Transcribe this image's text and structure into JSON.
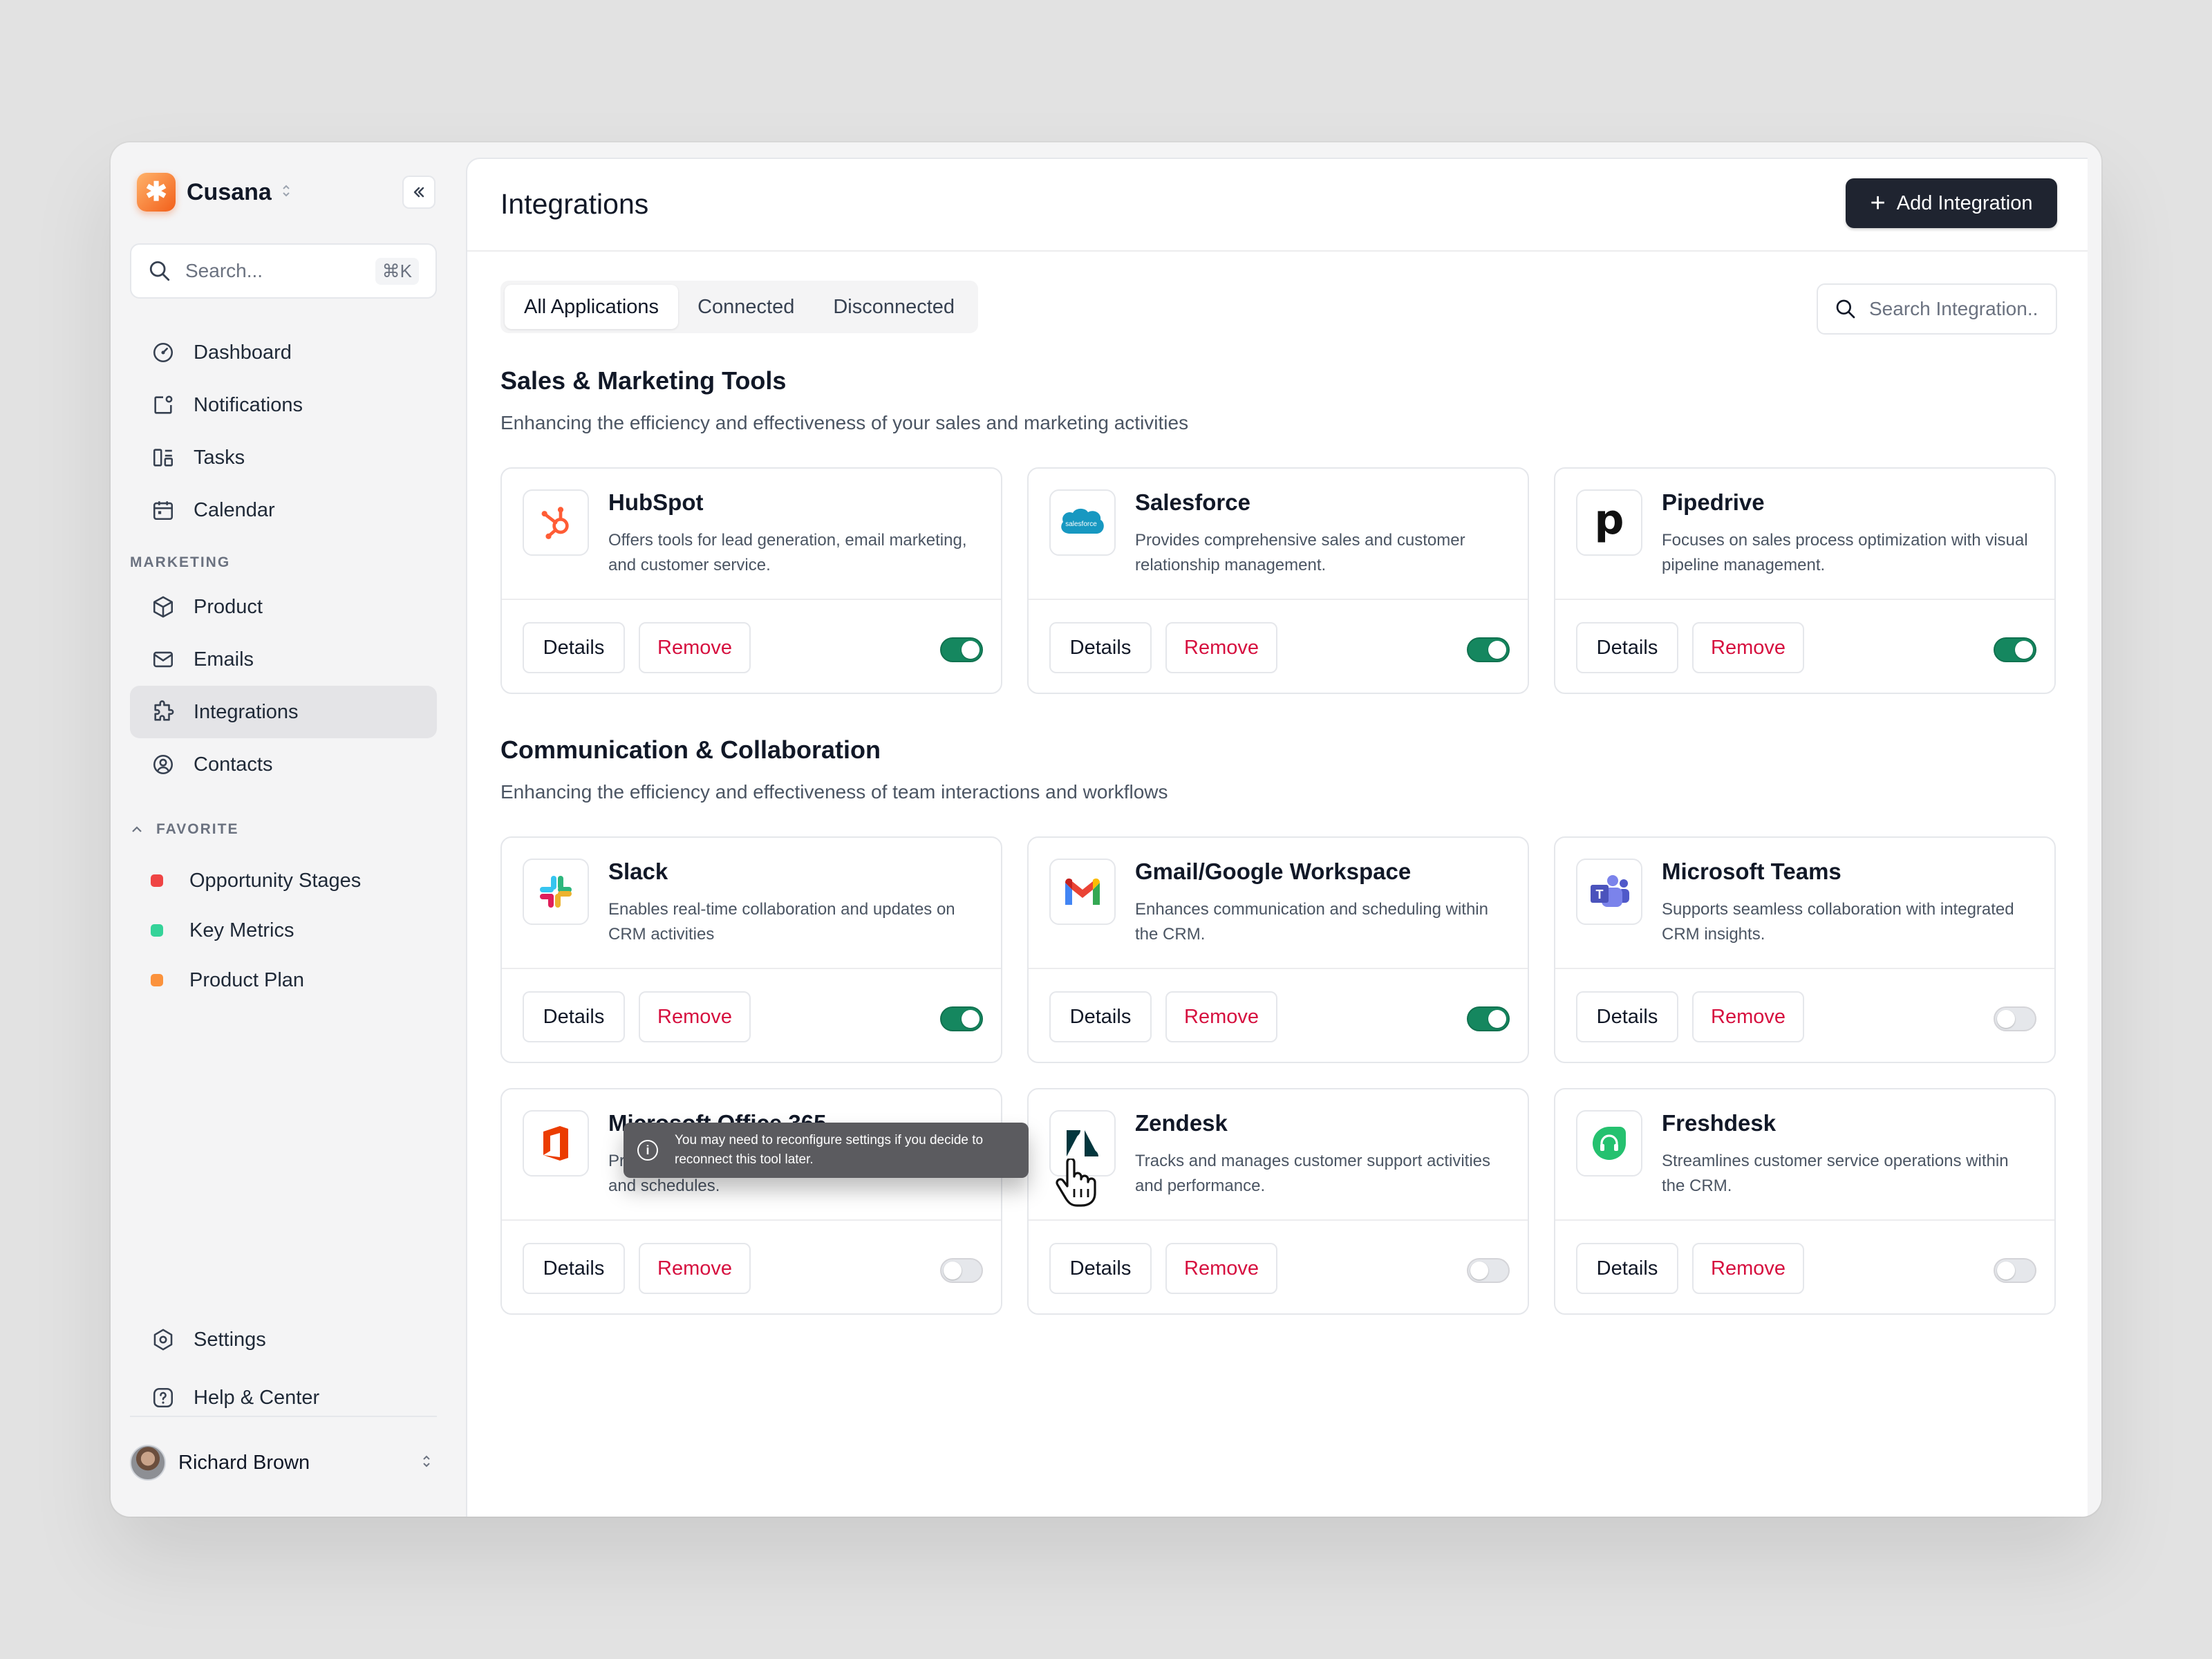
{
  "brand": {
    "name": "Cusana",
    "logo_glyph": "✱"
  },
  "sidebar": {
    "search_placeholder": "Search...",
    "search_shortcut": "⌘K",
    "nav": [
      {
        "label": "Dashboard",
        "icon": "dashboard-icon"
      },
      {
        "label": "Notifications",
        "icon": "notification-icon"
      },
      {
        "label": "Tasks",
        "icon": "tasks-icon"
      },
      {
        "label": "Calendar",
        "icon": "calendar-icon"
      }
    ],
    "marketing_label": "MARKETING",
    "marketing": [
      {
        "label": "Product",
        "icon": "cube-icon"
      },
      {
        "label": "Emails",
        "icon": "mail-icon"
      },
      {
        "label": "Integrations",
        "icon": "puzzle-icon",
        "active": true
      },
      {
        "label": "Contacts",
        "icon": "user-circle-icon"
      }
    ],
    "favorite_label": "FAVORITE",
    "favorites": [
      {
        "label": "Opportunity Stages",
        "color": "#ef4444"
      },
      {
        "label": "Key Metrics",
        "color": "#34d399"
      },
      {
        "label": "Product Plan",
        "color": "#fb923c"
      }
    ],
    "bottom": [
      {
        "label": "Settings",
        "icon": "settings-icon"
      },
      {
        "label": "Help & Center",
        "icon": "help-icon"
      }
    ],
    "user": {
      "name": "Richard Brown"
    }
  },
  "header": {
    "title": "Integrations",
    "add_button": "Add Integration"
  },
  "tabs": [
    {
      "label": "All Applications",
      "active": true
    },
    {
      "label": "Connected"
    },
    {
      "label": "Disconnected"
    }
  ],
  "search": {
    "placeholder": "Search Integration.."
  },
  "sections": [
    {
      "title": "Sales & Marketing Tools",
      "description": "Enhancing the efficiency and effectiveness of your sales and marketing activities",
      "cards": [
        {
          "name": "HubSpot",
          "description": "Offers tools for lead generation, email marketing, and customer service.",
          "enabled": true,
          "logo": "hubspot-logo"
        },
        {
          "name": "Salesforce",
          "description": "Provides comprehensive sales and customer relationship management.",
          "enabled": true,
          "logo": "salesforce-logo",
          "logo_text": "salesforce"
        },
        {
          "name": "Pipedrive",
          "description": "Focuses on sales process optimization with visual pipeline management.",
          "enabled": true,
          "logo": "pipedrive-logo",
          "logo_text": "p"
        }
      ]
    },
    {
      "title": "Communication & Collaboration",
      "description": "Enhancing the efficiency and effectiveness of team interactions and workflows",
      "cards": [
        {
          "name": "Slack",
          "description": "Enables real-time collaboration and updates on CRM activities",
          "enabled": true,
          "logo": "slack-logo"
        },
        {
          "name": "Gmail/Google Workspace",
          "description": "Enhances communication and scheduling within the CRM.",
          "enabled": true,
          "logo": "gmail-logo"
        },
        {
          "name": "Microsoft Teams",
          "description": "Supports seamless collaboration with integrated CRM insights.",
          "enabled": false,
          "logo": "teams-logo",
          "logo_text": "T"
        },
        {
          "name": "Microsoft Office 365",
          "description": "Provides a unified view of customer interactions and schedules.",
          "enabled": false,
          "logo": "office365-logo"
        },
        {
          "name": "Zendesk",
          "description": "Tracks and manages customer support activities and performance.",
          "enabled": false,
          "logo": "zendesk-logo"
        },
        {
          "name": "Freshdesk",
          "description": "Streamlines customer service operations within the CRM.",
          "enabled": false,
          "logo": "freshdesk-logo"
        }
      ]
    }
  ],
  "card_buttons": {
    "details": "Details",
    "remove": "Remove"
  },
  "tooltip": {
    "text": "You may need to reconfigure settings if you decide to reconnect this tool later.",
    "icon_glyph": "i"
  },
  "colors": {
    "toggle_on": "#15875f",
    "remove_text": "#d6103f",
    "add_button_bg": "#1f2430",
    "brand_orange": "#f25f1a"
  }
}
